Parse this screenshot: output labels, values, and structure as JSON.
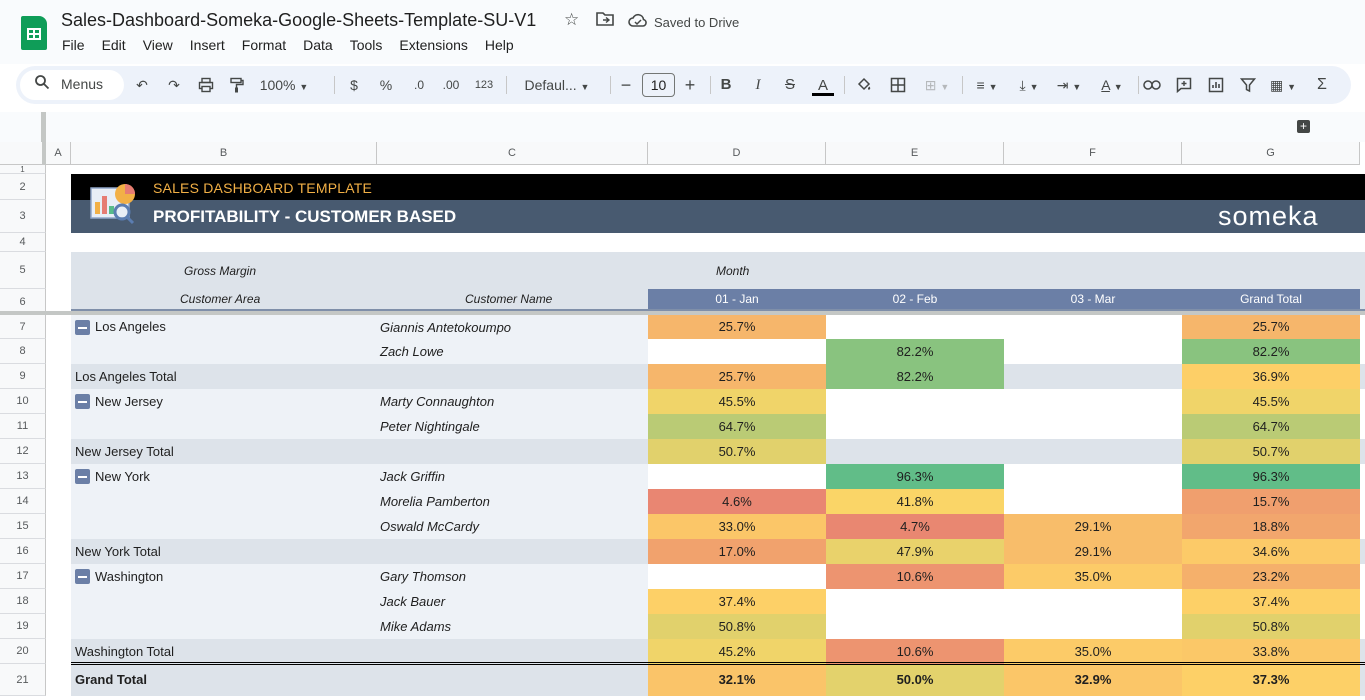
{
  "document": {
    "title": "Sales-Dashboard-Someka-Google-Sheets-Template-SU-V1",
    "save_status": "Saved to Drive"
  },
  "menu": [
    "File",
    "Edit",
    "View",
    "Insert",
    "Format",
    "Data",
    "Tools",
    "Extensions",
    "Help"
  ],
  "toolbar": {
    "search_label": "Menus",
    "zoom": "100%",
    "currency": "$",
    "percent": "%",
    "decrease_decimal": ".0",
    "increase_decimal": ".00",
    "number_format": "123",
    "font": "Defaul...",
    "font_size": "10"
  },
  "columns": [
    "A",
    "B",
    "C",
    "D",
    "E",
    "F",
    "G"
  ],
  "rows": [
    "1",
    "2",
    "3",
    "4",
    "5",
    "6",
    "7",
    "8",
    "9",
    "10",
    "11",
    "12",
    "13",
    "14",
    "15",
    "16",
    "17",
    "18",
    "19",
    "20",
    "21"
  ],
  "banner": {
    "subtitle": "SALES DASHBOARD TEMPLATE",
    "title": "PROFITABILITY - CUSTOMER BASED",
    "logo": "someka"
  },
  "pivot": {
    "value_label": "Gross Margin",
    "column_field": "Month",
    "area_label": "Customer Area",
    "name_label": "Customer Name",
    "months": [
      "01 - Jan",
      "02 - Feb",
      "03 - Mar",
      "Grand Total"
    ],
    "rows": [
      {
        "area": "Los Angeles",
        "name": "Giannis Antetokoumpo",
        "values": [
          "25.7%",
          "",
          "",
          "25.7%"
        ],
        "type": "first"
      },
      {
        "area": "",
        "name": "Zach Lowe",
        "values": [
          "",
          "82.2%",
          "",
          "82.2%"
        ],
        "type": "item"
      },
      {
        "area": "Los Angeles Total",
        "name": "",
        "values": [
          "25.7%",
          "82.2%",
          "",
          "36.9%"
        ],
        "type": "total"
      },
      {
        "area": "New Jersey",
        "name": "Marty Connaughton",
        "values": [
          "45.5%",
          "",
          "",
          "45.5%"
        ],
        "type": "first"
      },
      {
        "area": "",
        "name": "Peter Nightingale",
        "values": [
          "64.7%",
          "",
          "",
          "64.7%"
        ],
        "type": "item"
      },
      {
        "area": "New Jersey Total",
        "name": "",
        "values": [
          "50.7%",
          "",
          "",
          "50.7%"
        ],
        "type": "total"
      },
      {
        "area": "New York",
        "name": "Jack Griffin",
        "values": [
          "",
          "96.3%",
          "",
          "96.3%"
        ],
        "type": "first"
      },
      {
        "area": "",
        "name": "Morelia Pamberton",
        "values": [
          "4.6%",
          "41.8%",
          "",
          "15.7%"
        ],
        "type": "item"
      },
      {
        "area": "",
        "name": "Oswald McCardy",
        "values": [
          "33.0%",
          "4.7%",
          "29.1%",
          "18.8%"
        ],
        "type": "item"
      },
      {
        "area": "New York Total",
        "name": "",
        "values": [
          "17.0%",
          "47.9%",
          "29.1%",
          "34.6%"
        ],
        "type": "total"
      },
      {
        "area": "Washington",
        "name": "Gary Thomson",
        "values": [
          "",
          "10.6%",
          "35.0%",
          "23.2%"
        ],
        "type": "first"
      },
      {
        "area": "",
        "name": "Jack Bauer",
        "values": [
          "37.4%",
          "",
          "",
          "37.4%"
        ],
        "type": "item"
      },
      {
        "area": "",
        "name": "Mike Adams",
        "values": [
          "50.8%",
          "",
          "",
          "50.8%"
        ],
        "type": "item"
      },
      {
        "area": "Washington Total",
        "name": "",
        "values": [
          "45.2%",
          "10.6%",
          "35.0%",
          "33.8%"
        ],
        "type": "total"
      },
      {
        "area": "Grand Total",
        "name": "",
        "values": [
          "32.1%",
          "50.0%",
          "32.9%",
          "37.3%"
        ],
        "type": "grand"
      }
    ]
  },
  "colors": {
    "banner_black": "#000000",
    "banner_slate": "#485a70",
    "subtitle_orange": "#f2b046",
    "header_fill": "#dde3ea",
    "month_header_fill": "#6b7fa6",
    "sheets_green": "#0f9d58",
    "scale_low": "#e67c73",
    "scale_mid": "#ffd666",
    "scale_high": "#57bb8a"
  },
  "icons": [
    "sheets-logo-icon",
    "star-icon",
    "move-folder-icon",
    "cloud-saved-icon",
    "search-icon",
    "undo-icon",
    "redo-icon",
    "print-icon",
    "paint-format-icon",
    "bold-icon",
    "italic-icon",
    "strikethrough-icon",
    "text-color-icon",
    "fill-color-icon",
    "borders-icon",
    "merge-icon",
    "align-icon",
    "valign-icon",
    "wrap-icon",
    "rotate-icon",
    "link-icon",
    "comment-icon",
    "chart-icon",
    "filter-icon",
    "table-view-icon",
    "functions-icon",
    "collapse-group-icon",
    "add-icon"
  ]
}
